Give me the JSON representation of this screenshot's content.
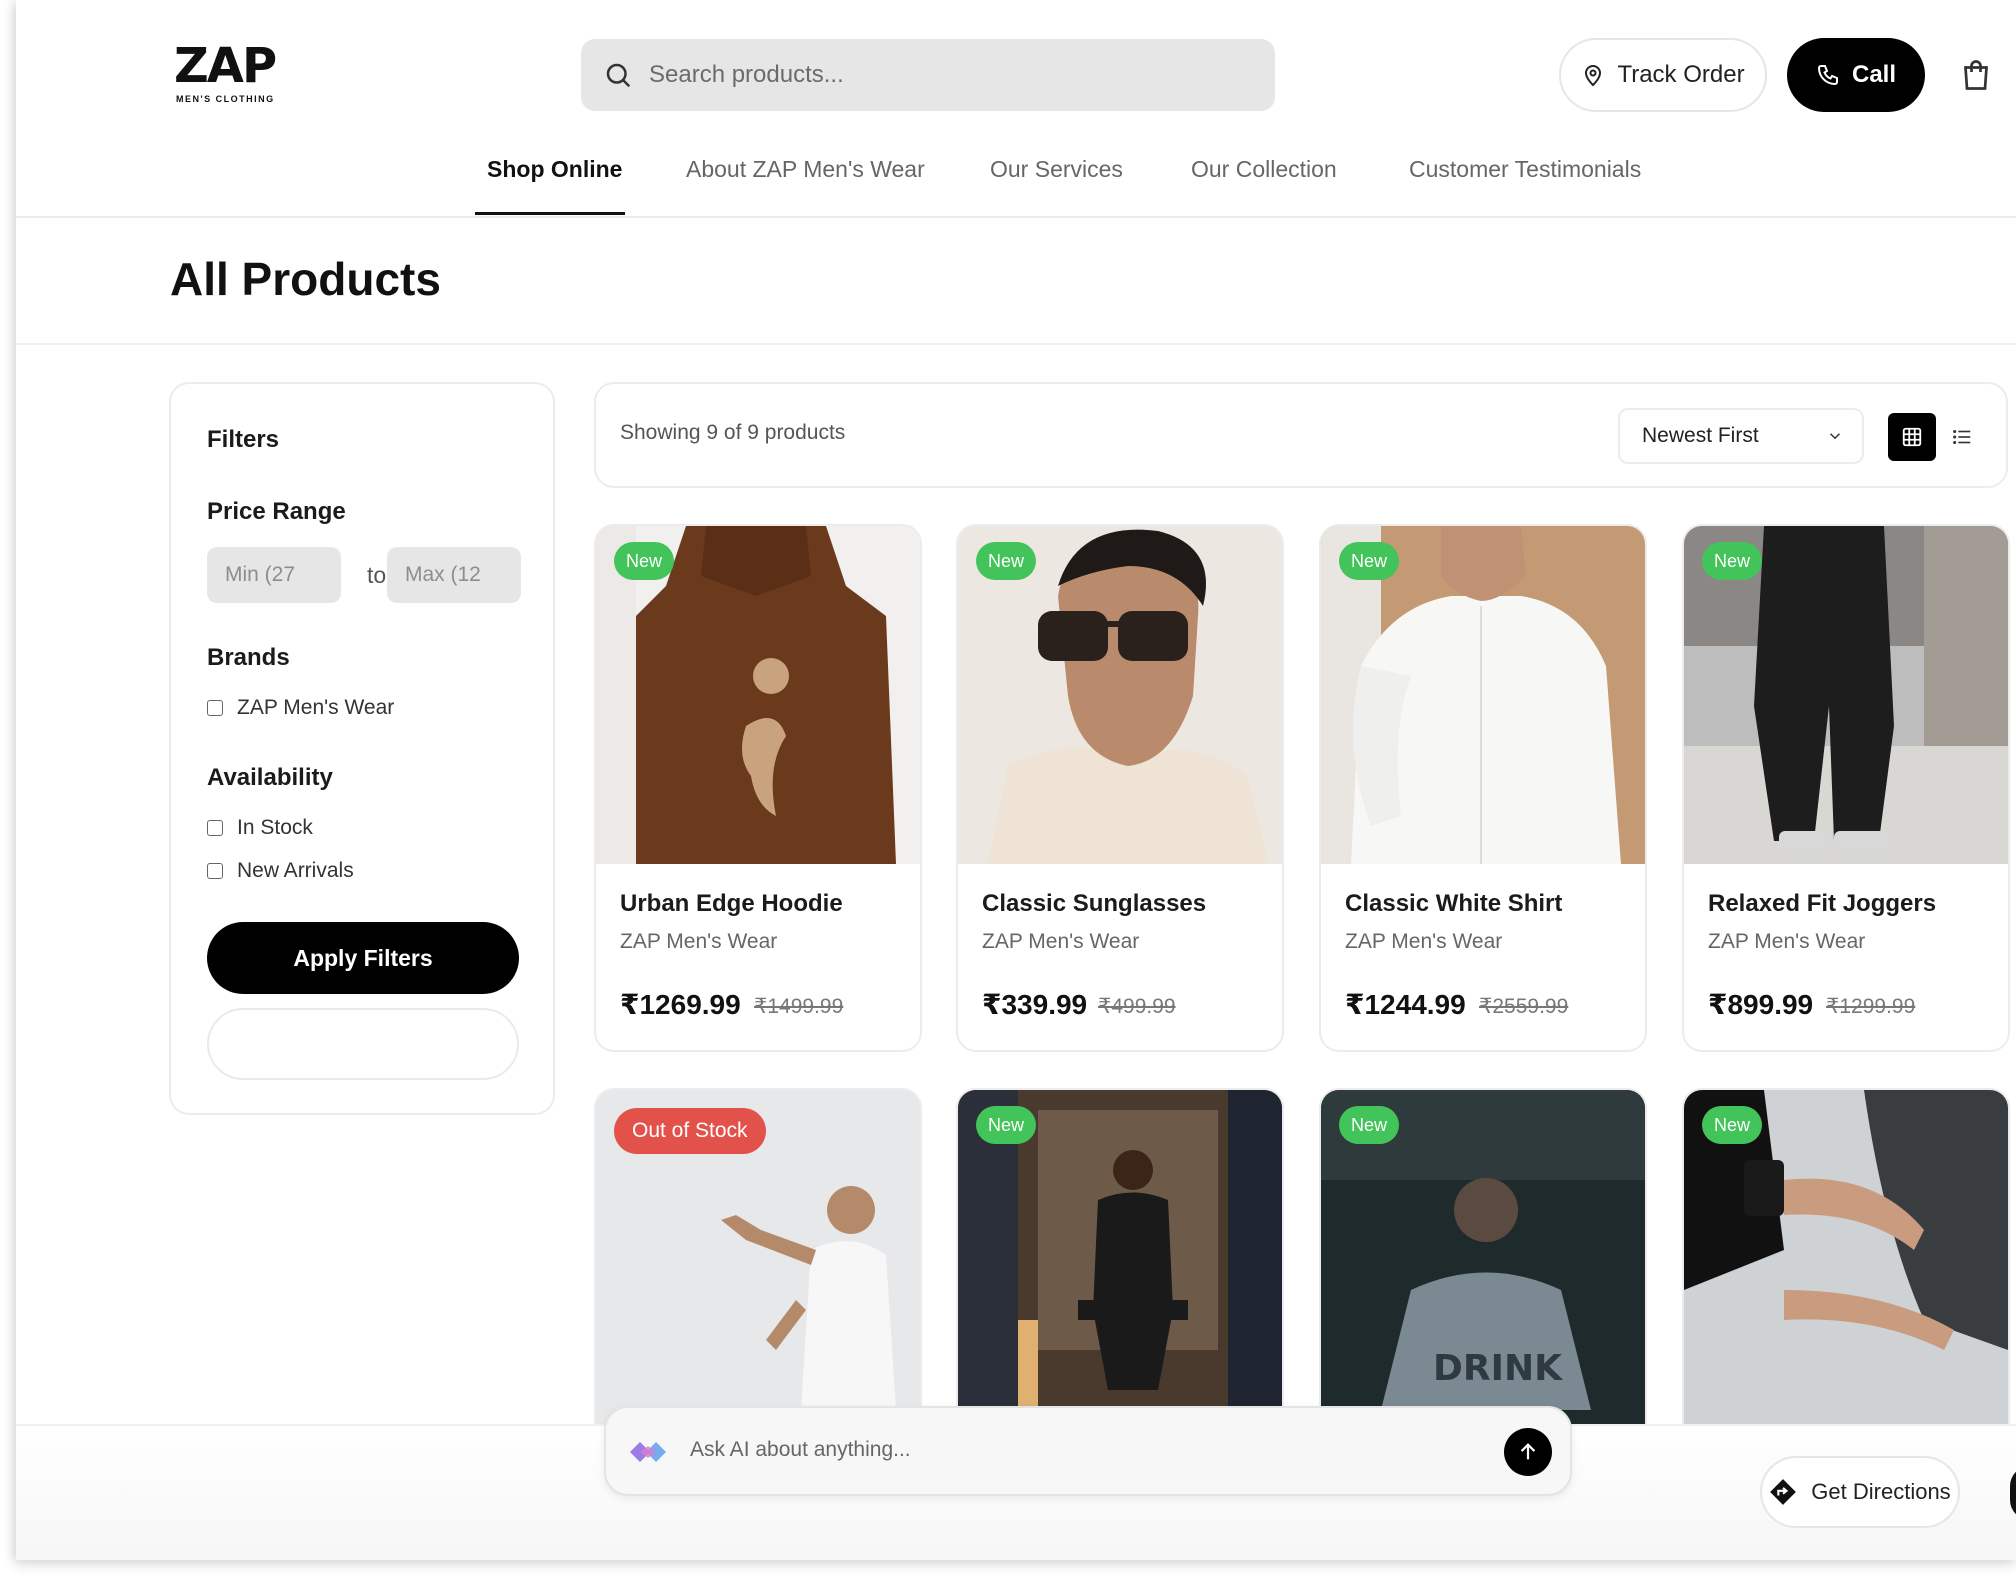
{
  "logo": {
    "main": "ZAP",
    "sub": "MEN'S CLOTHING"
  },
  "search": {
    "placeholder": "Search products..."
  },
  "header": {
    "track_order": "Track Order",
    "call": "Call"
  },
  "nav": [
    "Shop Online",
    "About ZAP Men's Wear",
    "Our Services",
    "Our Collection",
    "Customer Testimonials"
  ],
  "page_title": "All Products",
  "filters": {
    "title": "Filters",
    "price_range": "Price Range",
    "min_placeholder": "Min (27",
    "max_placeholder": "Max (12",
    "to": "to",
    "brands": "Brands",
    "brand_options": [
      "ZAP Men's Wear"
    ],
    "availability": "Availability",
    "availability_options": [
      "In Stock",
      "New Arrivals"
    ],
    "apply": "Apply Filters"
  },
  "toolbar": {
    "showing": "Showing 9 of 9 products",
    "sort": "Newest First"
  },
  "products": [
    {
      "badge": "New",
      "name": "Urban Edge Hoodie",
      "brand": "ZAP Men's Wear",
      "price": "₹1269.99",
      "old_price": "₹1499.99"
    },
    {
      "badge": "New",
      "name": "Classic Sunglasses",
      "brand": "ZAP Men's Wear",
      "price": "₹339.99",
      "old_price": "₹499.99"
    },
    {
      "badge": "New",
      "name": "Classic White Shirt",
      "brand": "ZAP Men's Wear",
      "price": "₹1244.99",
      "old_price": "₹2559.99"
    },
    {
      "badge": "New",
      "name": "Relaxed Fit Joggers",
      "brand": "ZAP Men's Wear",
      "price": "₹899.99",
      "old_price": "₹1299.99"
    },
    {
      "badge": "Out of Stock"
    },
    {
      "badge": "New"
    },
    {
      "badge": "New"
    },
    {
      "badge": "New"
    }
  ],
  "ai": {
    "placeholder": "Ask AI about anything..."
  },
  "directions": "Get Directions",
  "colors": {
    "accent": "#000000",
    "new_badge": "#43c45a",
    "out_of_stock_badge": "#e2524b"
  }
}
